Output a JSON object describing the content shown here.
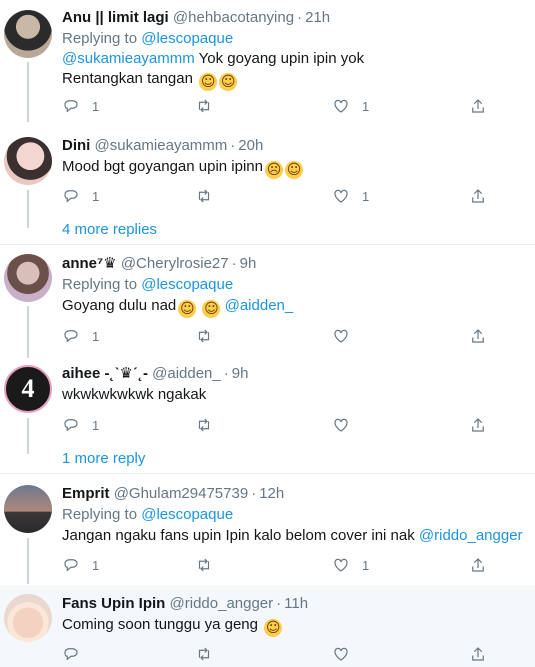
{
  "replies": [
    {
      "name": "Anu || limit lagi",
      "handle": "@hehbacotanying",
      "time": "21h",
      "replying_prefix": "Replying to",
      "replying_to": "@lescopaque",
      "mention": "@sukamieayammm",
      "text_after_mention": " Yok goyang upin ipin yok",
      "text_line2": "Rentangkan tangan",
      "emojis": "🤣🤣",
      "reply_count": "1",
      "retweet_count": "",
      "like_count": "1"
    },
    {
      "name": "Dini",
      "handle": "@sukamieayammm",
      "time": "20h",
      "text": "Mood bgt goyangan upin ipinn",
      "emojis": "😭😋",
      "reply_count": "1",
      "retweet_count": "",
      "like_count": "1"
    },
    {
      "more_replies": "4 more replies"
    },
    {
      "name": "anne",
      "name_suffix": "⁷♛",
      "handle": "@Cherylrosie27",
      "time": "9h",
      "replying_prefix": "Replying to",
      "replying_to": "@lescopaque",
      "text": "Goyang dulu nad",
      "emojis": "😀😀",
      "mention": " @aidden_",
      "reply_count": "1",
      "retweet_count": "",
      "like_count": ""
    },
    {
      "name": "aihee -˛ˋ♛ˊ˛-",
      "handle": "@aidden_",
      "time": "9h",
      "text": "wkwkwkwkwk ngakak",
      "reply_count": "1",
      "retweet_count": "",
      "like_count": ""
    },
    {
      "more_replies": "1 more reply"
    },
    {
      "name": "Emprit",
      "handle": "@Ghulam29475739",
      "time": "12h",
      "replying_prefix": "Replying to",
      "replying_to": "@lescopaque",
      "text": "Jangan ngaku fans upin Ipin kalo belom cover ini nak ",
      "mention": "@riddo_angger",
      "reply_count": "1",
      "retweet_count": "",
      "like_count": "1"
    },
    {
      "name": "Fans Upin Ipin",
      "handle": "@riddo_angger",
      "time": "11h",
      "text": "Coming soon tunggu ya geng",
      "emojis": "😂",
      "reply_count": "",
      "retweet_count": "",
      "like_count": ""
    }
  ],
  "dot": "·",
  "colors": {
    "link": "#1b95e0",
    "muted": "#657786",
    "highlight_bg": "#f5f8fa"
  },
  "icons": [
    "reply-icon",
    "retweet-icon",
    "like-icon",
    "share-icon"
  ]
}
